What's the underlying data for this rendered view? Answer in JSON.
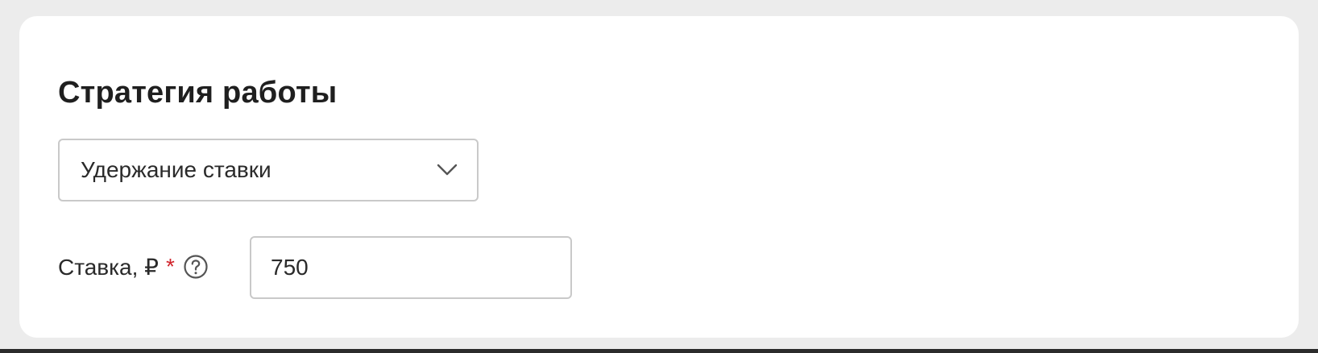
{
  "section": {
    "title": "Стратегия работы"
  },
  "strategy_select": {
    "value": "Удержание ставки",
    "icon": "chevron-down-icon"
  },
  "rate_field": {
    "label": "Ставка, ₽",
    "required_mark": "*",
    "help_icon": "question-circle-icon",
    "value": "750"
  },
  "colors": {
    "background": "#ececec",
    "card": "#ffffff",
    "border": "#c9c9c9",
    "text": "#2a2a2a",
    "required": "#d0232b"
  }
}
